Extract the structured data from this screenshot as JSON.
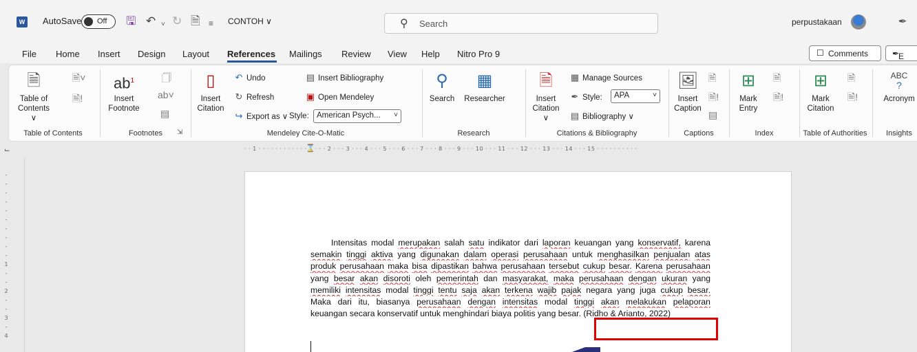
{
  "titlebar": {
    "app_icon": "W",
    "autosave_label": "AutoSave",
    "autosave_state": "Off",
    "document_name": "CONTOH ∨",
    "search_placeholder": "Search",
    "username": "perpustakaan"
  },
  "menu": {
    "items": [
      "File",
      "Home",
      "Insert",
      "Design",
      "Layout",
      "References",
      "Mailings",
      "Review",
      "View",
      "Help",
      "Nitro Pro 9"
    ],
    "active": "References",
    "comments_label": "Comments",
    "edit_label": "E"
  },
  "ribbon": {
    "toc": {
      "btn1": "Table of",
      "btn2": "Contents ∨",
      "group": "Table of Contents"
    },
    "footnotes": {
      "insert1": "Insert",
      "insert2": "Footnote",
      "ab": "ab",
      "sup": "1",
      "group": "Footnotes"
    },
    "mendeley": {
      "insert1": "Insert",
      "insert2": "Citation",
      "undo": "Undo",
      "refresh": "Refresh",
      "export": "Export as ∨",
      "insert_bib": "Insert Bibliography",
      "open_mendeley": "Open Mendeley",
      "style_label": "Style:",
      "style_value": "American Psych...",
      "group": "Mendeley Cite-O-Matic"
    },
    "research": {
      "search": "Search",
      "researcher": "Researcher",
      "group": "Research"
    },
    "citations": {
      "insert1": "Insert",
      "insert2": "Citation ∨",
      "manage": "Manage Sources",
      "style_label": "Style:",
      "style_value": "APA",
      "bibliography": "Bibliography ∨",
      "group": "Citations & Bibliography"
    },
    "captions": {
      "insert1": "Insert",
      "insert2": "Caption",
      "group": "Captions"
    },
    "index": {
      "mark1": "Mark",
      "mark2": "Entry",
      "group": "Index"
    },
    "authorities": {
      "mark1": "Mark",
      "mark2": "Citation",
      "group": "Table of Authorities"
    },
    "insights": {
      "abc": "ABC",
      "acronym": "Acronym",
      "group": "Insights"
    }
  },
  "ruler": {
    "horizontal": "· · 1 · · · · · · · · · · · · 1 · · · 2 · · · 3 · · · 4 · · · 5 · · · 6 · · · 7 · · · 8 · · · 9 · · · 10 · · · 11 · · · 12 · · · 13 · · · 14 · · · 15 · · · · · · · · · ·",
    "vertical": [
      "-",
      "-",
      "-",
      "-",
      "-",
      "-",
      "-",
      "-",
      "-",
      "-",
      "1",
      "-",
      "-",
      "2",
      "-",
      "-",
      "3",
      "-",
      "4"
    ]
  },
  "document": {
    "lines": [
      "Intensitas modal merupakan salah satu indikator dari laporan keuangan yang konservatif, karena",
      "semakin tinggi aktiva yang digunakan dalam operasi perusahaan untuk menghasilkan penjualan atas",
      "produk perusahaan maka bisa dipastikan bahwa perusahaan tersebut cukup besar. Karena perusahaan",
      "yang besar akan disoroti oleh pemerintah dan masyarakat, maka perusahaan dengan ukuran yang",
      "memiliki intensitas modal tinggi tentu saja akan terkena wajib pajak negara yang juga cukup besar.",
      "Maka dari itu, biasanya perusahaan dengan intensitas modal tinggi akan melakukan pelaporan",
      "keuangan secara konservatif untuk menghindari biaya politis yang besar. (Ridho & Arianto, 2022)"
    ]
  }
}
